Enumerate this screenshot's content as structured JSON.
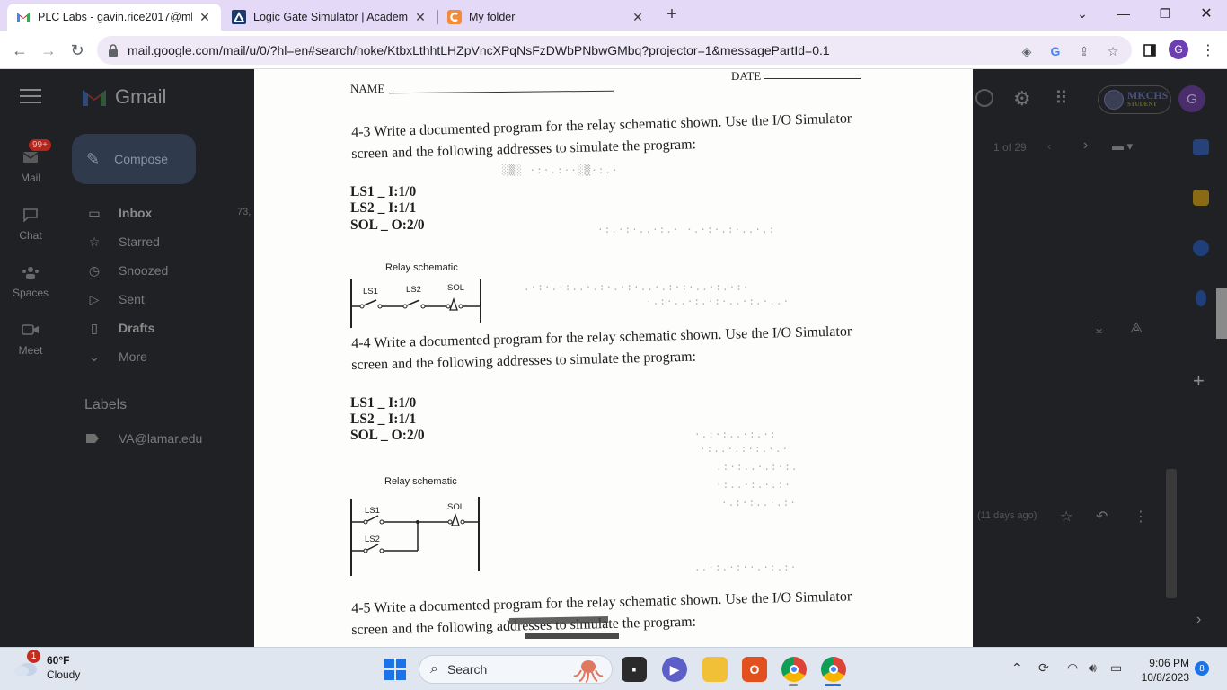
{
  "browser": {
    "tabs": [
      {
        "title": "PLC Labs - gavin.rice2017@mkch",
        "active": true,
        "icon": "gmail-icon"
      },
      {
        "title": "Logic Gate Simulator | Academo",
        "active": false,
        "icon": "academo-icon"
      },
      {
        "title": "My folder",
        "active": false,
        "icon": "canva-icon"
      }
    ],
    "new_tab": "+",
    "url": "mail.google.com/mail/u/0/?hl=en#search/hoke/KtbxLthhtLHZpVncXPqNsFzDWbPNbwGMbq?projector=1&messagePartId=0.1",
    "profile_initial": "G"
  },
  "gmail": {
    "brand": "Gmail",
    "compose_label": "Compose",
    "mail_badge": "99+",
    "rail": [
      {
        "label": "Mail",
        "icon": "mail-icon"
      },
      {
        "label": "Chat",
        "icon": "chat-icon"
      },
      {
        "label": "Spaces",
        "icon": "spaces-icon"
      },
      {
        "label": "Meet",
        "icon": "meet-icon"
      }
    ],
    "nav": [
      {
        "label": "Inbox",
        "icon": "inbox-icon",
        "bold": true
      },
      {
        "label": "Starred",
        "icon": "star-icon",
        "bold": false
      },
      {
        "label": "Snoozed",
        "icon": "clock-icon",
        "bold": false
      },
      {
        "label": "Sent",
        "icon": "send-icon",
        "bold": false
      },
      {
        "label": "Drafts",
        "icon": "draft-icon",
        "bold": true
      },
      {
        "label": "More",
        "icon": "chevron-down-icon",
        "bold": false
      }
    ],
    "inbox_count": "73,",
    "labels_heading": "Labels",
    "labels": [
      {
        "label": "VA@lamar.edu"
      }
    ],
    "pagination": "1 of 29",
    "email_time": "(11 days ago)",
    "school_logo": {
      "name": "MKCHS",
      "sub": "STUDENT"
    },
    "avatar_initial": "G"
  },
  "document": {
    "name_label": "NAME",
    "date_label": "DATE",
    "q43": {
      "line1": "4-3 Write a documented program for the relay schematic shown. Use the I/O Simulator",
      "line2": "screen and the following addresses to simulate the program:",
      "addresses": [
        "LS1 _ I:1/0",
        "LS2 _ I:1/1",
        "SOL _ O:2/0"
      ],
      "schematic_title": "Relay schematic",
      "labels": [
        "LS1",
        "LS2",
        "SOL"
      ]
    },
    "q44": {
      "line1": "4-4 Write a documented program for the relay schematic shown. Use the I/O Simulator",
      "line2": "screen and the following addresses to simulate the program:",
      "addresses": [
        "LS1 _ I:1/0",
        "LS2 _ I:1/1",
        "SOL _ O:2/0"
      ],
      "schematic_title": "Relay schematic",
      "labels": [
        "LS1",
        "LS2",
        "SOL"
      ]
    },
    "q45": {
      "line1": "4-5 Write a documented program for the relay schematic shown. Use the I/O Simulator",
      "line2": "screen and the following addresses to simulate the program:"
    }
  },
  "taskbar": {
    "weather_temp": "60°F",
    "weather_desc": "Cloudy",
    "weather_badge": "1",
    "search_label": "Search",
    "time": "9:06 PM",
    "date": "10/8/2023",
    "notifications": "8"
  },
  "colors": {
    "tabbar": "#e4d9f7",
    "gmail_bg": "#202124",
    "taskbar": "#dfe6ef",
    "accent": "#1a73e8"
  }
}
